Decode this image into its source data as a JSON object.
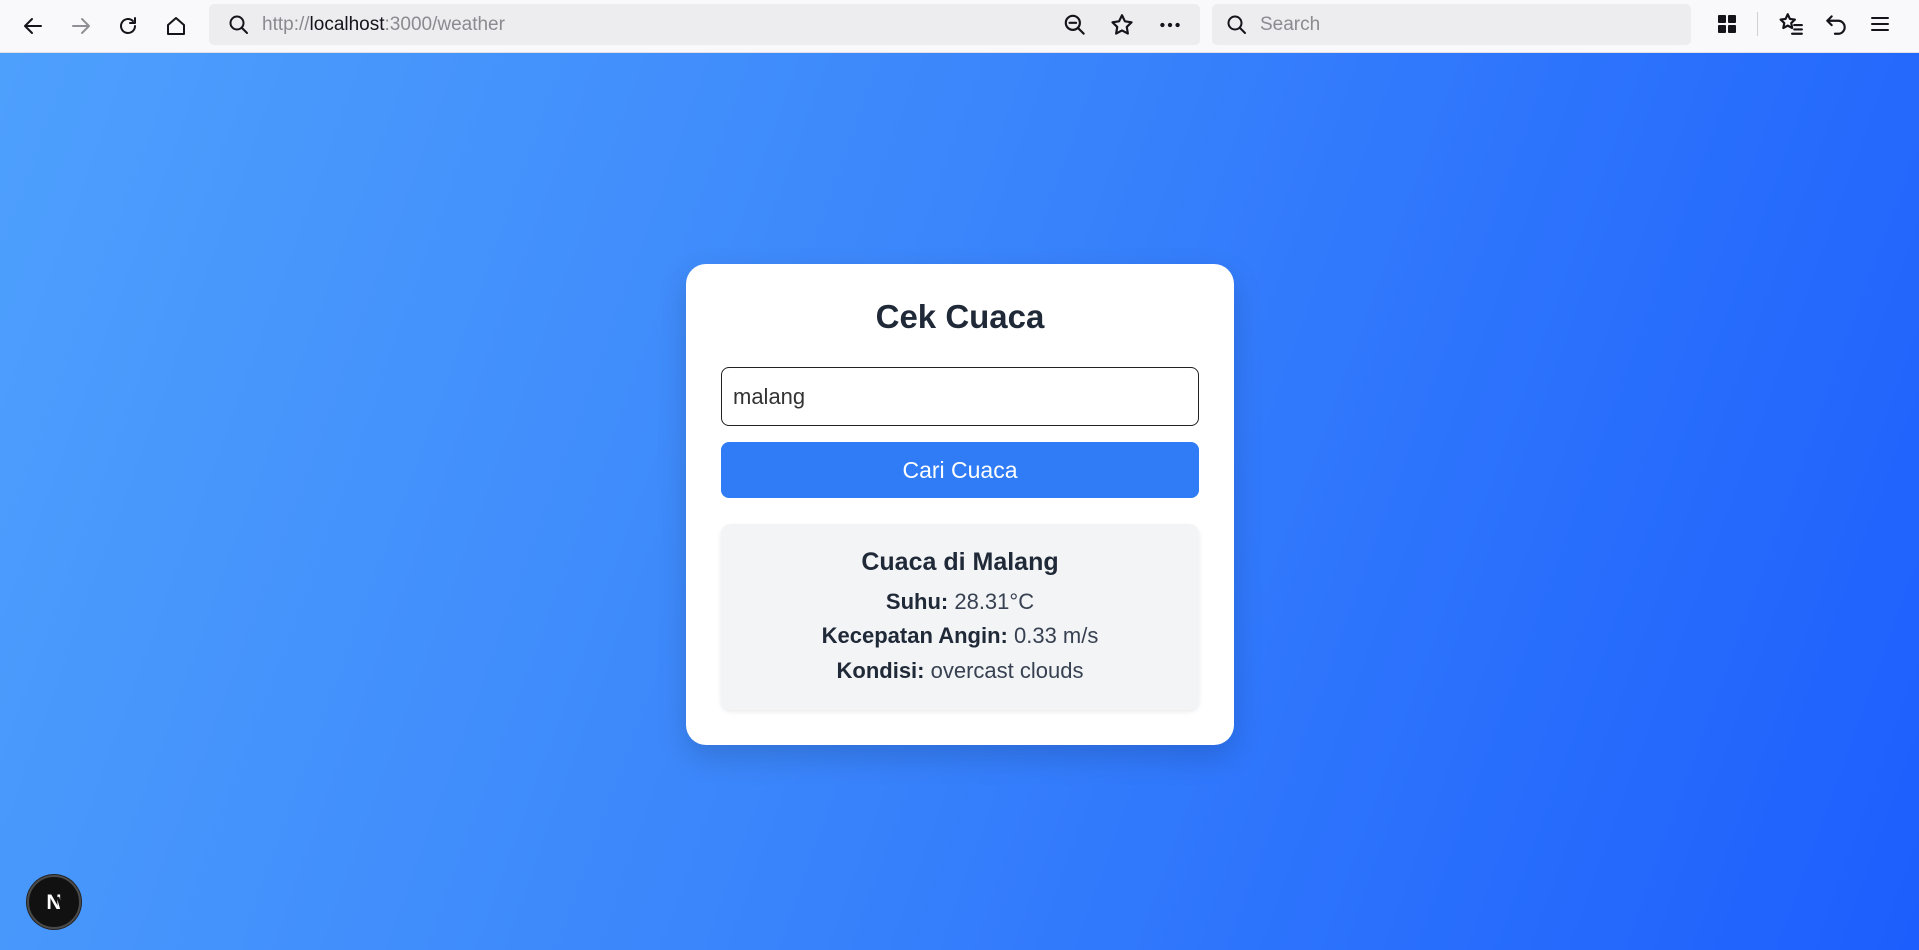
{
  "browser": {
    "url_prefix": "http://",
    "url_host": "localhost",
    "url_rest": ":3000/weather",
    "search_placeholder": "Search"
  },
  "app": {
    "title": "Cek Cuaca",
    "city_value": "malang",
    "button_label": "Cari Cuaca",
    "result": {
      "heading": "Cuaca di Malang",
      "temp_label": "Suhu:",
      "temp_value": "28.31°C",
      "wind_label": "Kecepatan Angin:",
      "wind_value": "0.33 m/s",
      "condition_label": "Kondisi:",
      "condition_value": "overcast clouds"
    }
  },
  "badge": {
    "letter": "N"
  },
  "colors": {
    "accent": "#2f7cf6",
    "gradient_start": "#4ea0fd",
    "gradient_end": "#1c5efd"
  }
}
